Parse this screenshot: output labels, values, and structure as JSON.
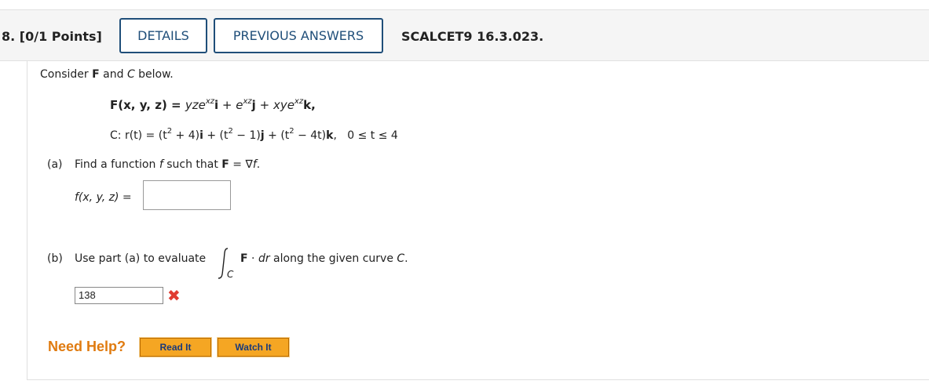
{
  "header": {
    "question_number": "8. [0/1 Points]",
    "details_label": "DETAILS",
    "previous_answers_label": "PREVIOUS ANSWERS",
    "question_id": "SCALCET9 16.3.023."
  },
  "problem": {
    "intro_pre": "Consider ",
    "intro_F": "F",
    "intro_and": " and ",
    "intro_C": "C",
    "intro_post": " below.",
    "F_def": {
      "lhs": "F(x, y, z) = ",
      "yz": "yze",
      "exp1": "xz",
      "i": "i",
      "plus1": " + ",
      "e2": "e",
      "exp2": "xz",
      "j": "j",
      "plus2": " + ",
      "xy": "xye",
      "exp3": "xz",
      "k": "k",
      "end": ","
    },
    "C_def": {
      "lhs": "C: r(t) = ",
      "p1": "(t",
      "exp_a": "2",
      "p1b": " + 4)",
      "i": "i",
      "plus1": " + ",
      "p2": "(t",
      "exp_b": "2",
      "p2b": " − 1)",
      "j": "j",
      "plus2": " + ",
      "p3": "(t",
      "exp_c": "2",
      "p3b": " − 4t)",
      "k": "k",
      "range": "0 ≤ t ≤ 4"
    },
    "part_a": {
      "label": "(a)",
      "text_pre": "Find a function ",
      "f": "f",
      "text_mid": " such that ",
      "F": "F",
      "eq": " = ∇",
      "f2": "f",
      "dot": ".",
      "answer_label": "f(x, y, z) =",
      "answer_value": ""
    },
    "part_b": {
      "label": "(b)",
      "text_pre": "Use part (a) to evaluate",
      "sub_C": "C",
      "F": "F",
      "dot_op": " · ",
      "dr": "dr",
      "text_post": " along the given curve ",
      "curve": "C",
      "period": ".",
      "answer_value": "138",
      "status": "incorrect"
    }
  },
  "help": {
    "need_help": "Need Help?",
    "read_it": "Read It",
    "watch_it": "Watch It"
  },
  "colors": {
    "button_border": "#1f4e79",
    "wrong_mark": "#e03c31",
    "need_help": "#e07b10",
    "help_button": "#f5a623"
  }
}
